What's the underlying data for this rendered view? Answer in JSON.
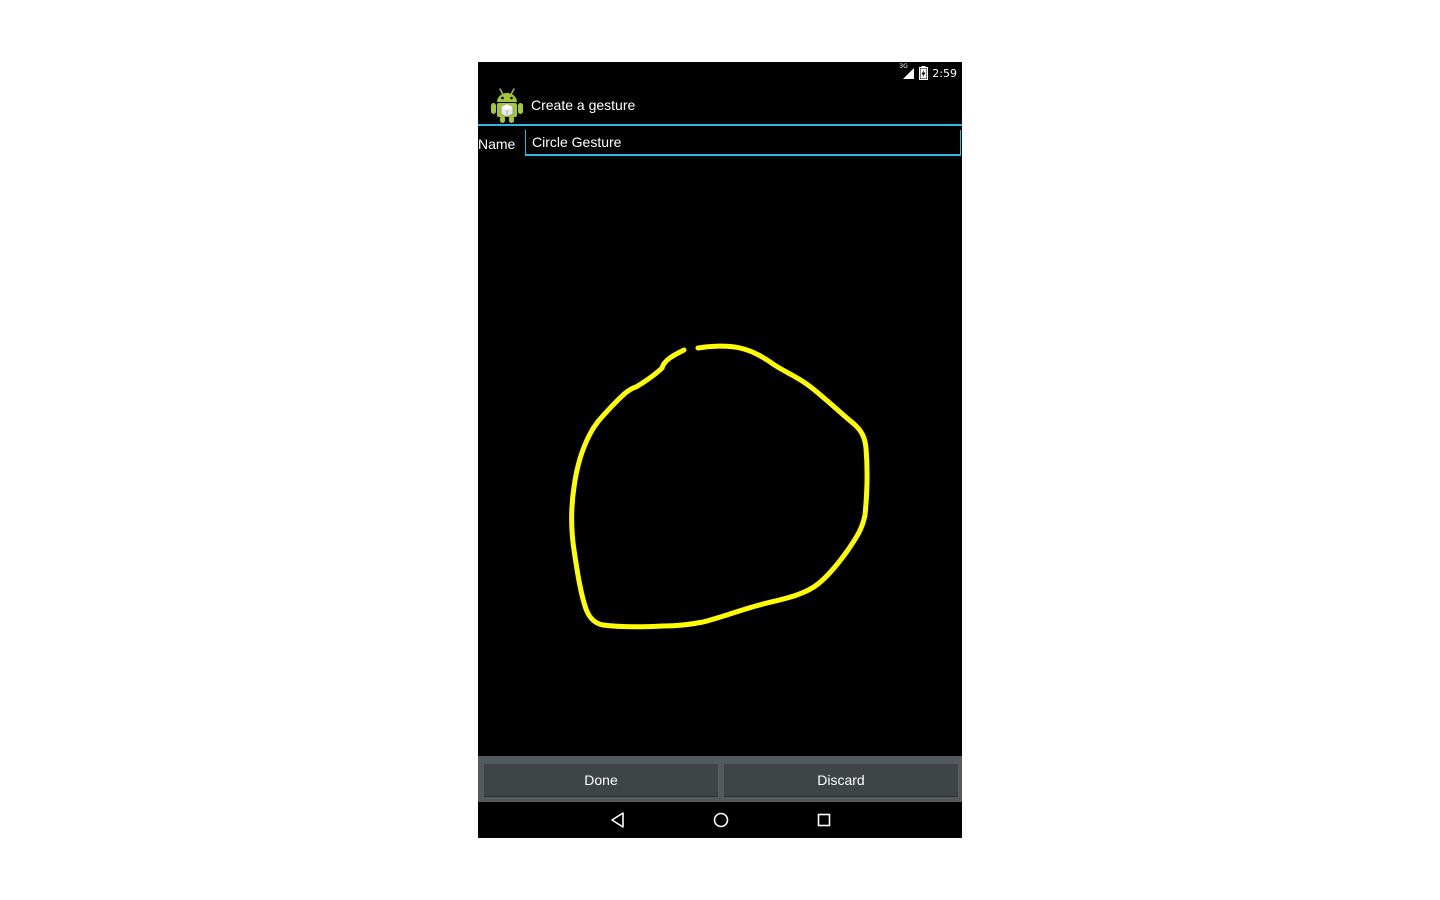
{
  "status_bar": {
    "network": "3G",
    "time": "2:59"
  },
  "action_bar": {
    "title": "Create a gesture",
    "icon": "android-robot-icon"
  },
  "form": {
    "name_label": "Name",
    "name_value": "Circle Gesture"
  },
  "gesture": {
    "stroke_color": "#ffff00"
  },
  "buttons": {
    "done_label": "Done",
    "discard_label": "Discard"
  },
  "navigation": {
    "back_icon": "back-triangle-icon",
    "home_icon": "home-circle-icon",
    "recents_icon": "recents-square-icon"
  },
  "colors": {
    "accent": "#33b5e5",
    "button_bar": "#555a5e",
    "button": "#3f4447"
  }
}
